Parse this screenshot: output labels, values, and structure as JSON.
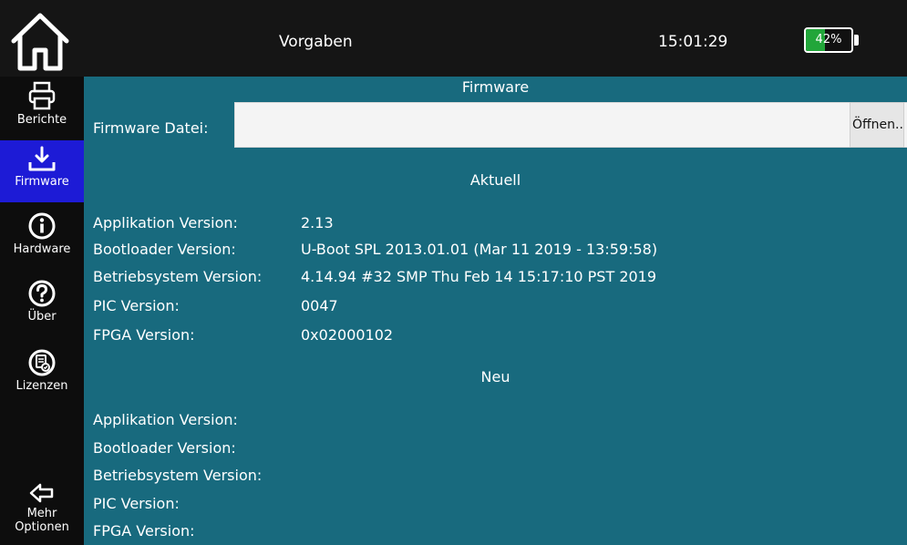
{
  "header": {
    "title": "Vorgaben",
    "time": "15:01:29",
    "battery": {
      "percent_text": "42%",
      "level": 0.42,
      "color": "#22a63a"
    },
    "home_icon": "home-icon"
  },
  "sidebar": {
    "items": [
      {
        "label": "Berichte",
        "icon": "printer-icon"
      },
      {
        "label": "Firmware",
        "icon": "download-icon",
        "active": true
      },
      {
        "label": "Hardware",
        "icon": "info-icon"
      },
      {
        "label": "Über",
        "icon": "help-icon"
      },
      {
        "label": "Lizenzen",
        "icon": "license-icon"
      }
    ],
    "more": {
      "label_line1": "Mehr",
      "label_line2": "Optionen",
      "icon": "arrow-left-icon"
    }
  },
  "firmware": {
    "section_title": "Firmware",
    "file_label": "Firmware Datei:",
    "file_value": "",
    "open_button": "Öffnen.."
  },
  "current": {
    "title": "Aktuell",
    "rows": [
      {
        "label": "Applikation Version:",
        "value": "2.13"
      },
      {
        "label": "Bootloader Version:",
        "value": "U-Boot SPL 2013.01.01 (Mar 11 2019 - 13:59:58)"
      },
      {
        "label": "Betriebsystem Version:",
        "value": "4.14.94 #32 SMP Thu Feb 14 15:17:10 PST 2019"
      },
      {
        "label": "PIC Version:",
        "value": "0047"
      },
      {
        "label": "FPGA Version:",
        "value": "0x02000102"
      }
    ]
  },
  "new": {
    "title": "Neu",
    "rows": [
      {
        "label": "Applikation Version:",
        "value": ""
      },
      {
        "label": "Bootloader Version:",
        "value": ""
      },
      {
        "label": "Betriebsystem Version:",
        "value": ""
      },
      {
        "label": "PIC Version:",
        "value": ""
      },
      {
        "label": "FPGA Version:",
        "value": ""
      }
    ]
  },
  "colors": {
    "main_bg": "#186a7e",
    "sidebar_active": "#1d1bd6",
    "bar_bg": "#151515"
  }
}
